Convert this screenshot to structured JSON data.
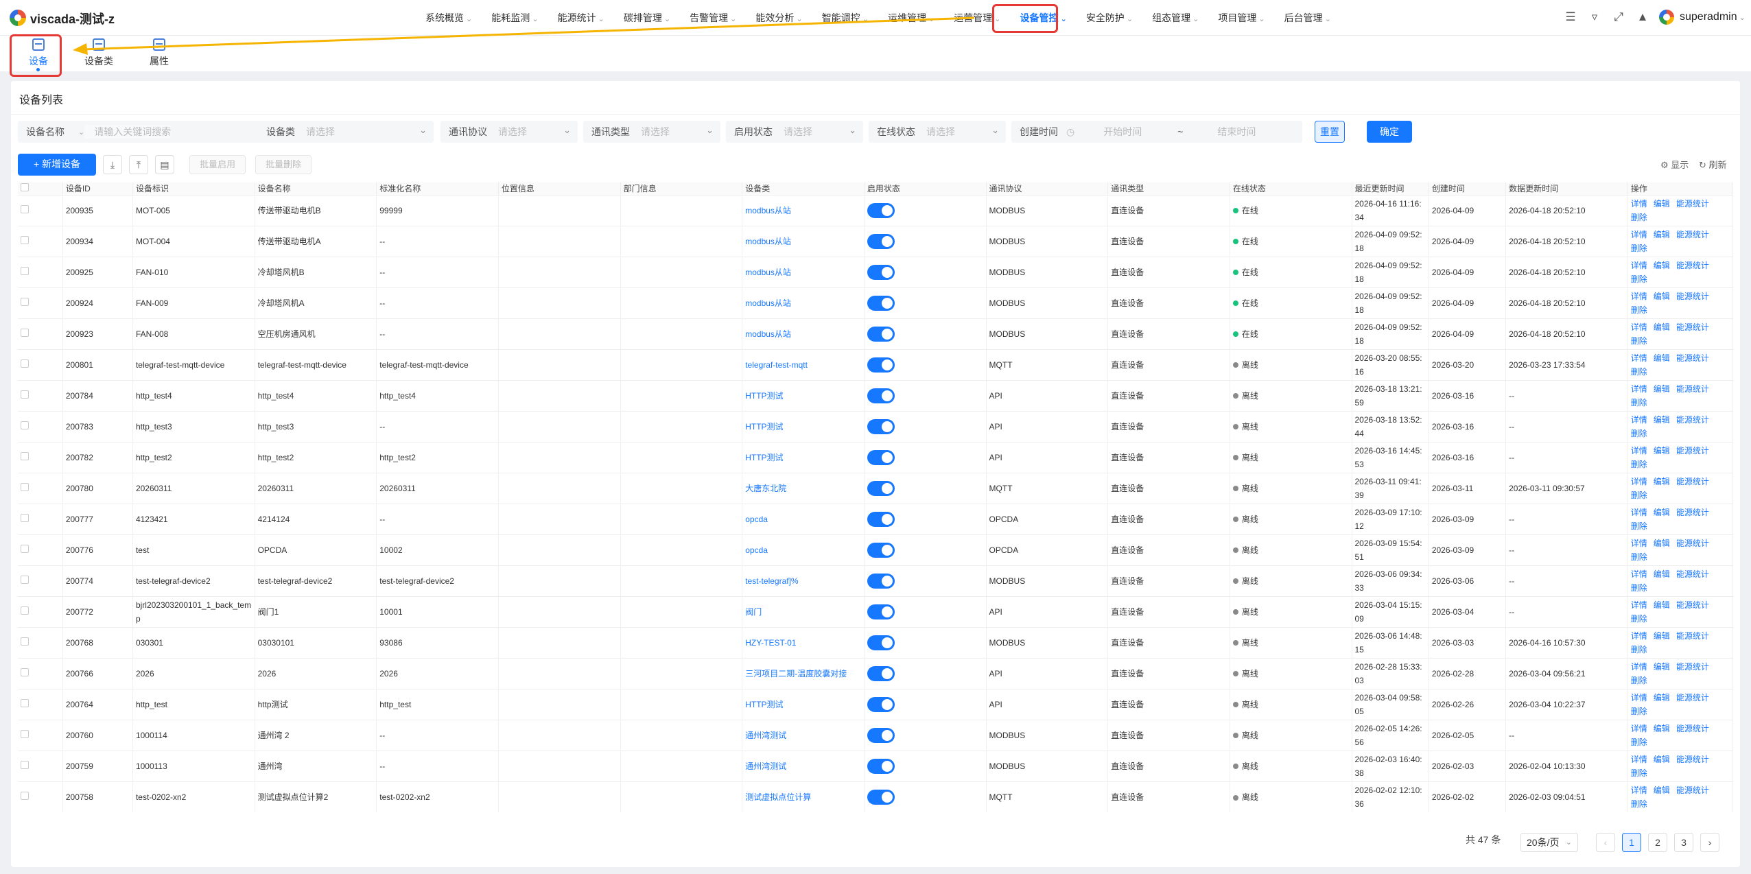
{
  "app": {
    "title": "viscada-测试-z"
  },
  "nav": {
    "items": [
      "系统概览",
      "能耗监测",
      "能源统计",
      "碳排管理",
      "告警管理",
      "能效分析",
      "智能调控",
      "运维管理",
      "运营管理",
      "设备管控",
      "安全防护",
      "组态管理",
      "项目管理",
      "后台管理"
    ],
    "active": "设备管控"
  },
  "user": {
    "name": "superadmin"
  },
  "subnav": {
    "items": [
      "设备",
      "设备类",
      "属性"
    ],
    "active": "设备"
  },
  "page": {
    "title": "设备列表"
  },
  "filters": {
    "name_select": "设备名称",
    "keyword_placeholder": "请输入关键词搜索",
    "device_class": {
      "label": "设备类",
      "placeholder": "请选择"
    },
    "protocol": {
      "label": "通讯协议",
      "placeholder": "请选择"
    },
    "comm_type": {
      "label": "通讯类型",
      "placeholder": "请选择"
    },
    "enable_status": {
      "label": "启用状态",
      "placeholder": "请选择"
    },
    "online_status": {
      "label": "在线状态",
      "placeholder": "请选择"
    },
    "created_time": {
      "label": "创建时间",
      "start": "开始时间",
      "sep": "~",
      "end": "结束时间"
    },
    "reset": "重置",
    "confirm": "确定"
  },
  "toolbar": {
    "add": "+ 新增设备",
    "batch_enable": "批量启用",
    "batch_delete": "批量删除",
    "display": "显示",
    "refresh": "刷新"
  },
  "table": {
    "columns": [
      "设备ID",
      "设备标识",
      "设备名称",
      "标准化名称",
      "位置信息",
      "部门信息",
      "设备类",
      "启用状态",
      "通讯协议",
      "通讯类型",
      "在线状态",
      "最近更新时间",
      "创建时间",
      "数据更新时间",
      "操作"
    ],
    "actions": [
      "详情",
      "编辑",
      "能源统计",
      "删除"
    ],
    "rows": [
      {
        "id": "200935",
        "key": "MOT-005",
        "name": "传送带驱动电机B",
        "std": "99999",
        "cls": "modbus从站",
        "protocol": "MODBUS",
        "type": "直连设备",
        "online": "在线",
        "updated": "2026-04-16 11:16:34",
        "created": "2026-04-09",
        "data_updated": "2026-04-18 20:52:10"
      },
      {
        "id": "200934",
        "key": "MOT-004",
        "name": "传送带驱动电机A",
        "std": "--",
        "cls": "modbus从站",
        "protocol": "MODBUS",
        "type": "直连设备",
        "online": "在线",
        "updated": "2026-04-09 09:52:18",
        "created": "2026-04-09",
        "data_updated": "2026-04-18 20:52:10"
      },
      {
        "id": "200925",
        "key": "FAN-010",
        "name": "冷却塔风机B",
        "std": "--",
        "cls": "modbus从站",
        "protocol": "MODBUS",
        "type": "直连设备",
        "online": "在线",
        "updated": "2026-04-09 09:52:18",
        "created": "2026-04-09",
        "data_updated": "2026-04-18 20:52:10"
      },
      {
        "id": "200924",
        "key": "FAN-009",
        "name": "冷却塔风机A",
        "std": "--",
        "cls": "modbus从站",
        "protocol": "MODBUS",
        "type": "直连设备",
        "online": "在线",
        "updated": "2026-04-09 09:52:18",
        "created": "2026-04-09",
        "data_updated": "2026-04-18 20:52:10"
      },
      {
        "id": "200923",
        "key": "FAN-008",
        "name": "空压机房通风机",
        "std": "--",
        "cls": "modbus从站",
        "protocol": "MODBUS",
        "type": "直连设备",
        "online": "在线",
        "updated": "2026-04-09 09:52:18",
        "created": "2026-04-09",
        "data_updated": "2026-04-18 20:52:10"
      },
      {
        "id": "200801",
        "key": "telegraf-test-mqtt-device",
        "name": "telegraf-test-mqtt-device",
        "std": "telegraf-test-mqtt-device",
        "cls": "telegraf-test-mqtt",
        "protocol": "MQTT",
        "type": "直连设备",
        "online": "离线",
        "updated": "2026-03-20 08:55:16",
        "created": "2026-03-20",
        "data_updated": "2026-03-23 17:33:54"
      },
      {
        "id": "200784",
        "key": "http_test4",
        "name": "http_test4",
        "std": "http_test4",
        "cls": "HTTP测试",
        "protocol": "API",
        "type": "直连设备",
        "online": "离线",
        "updated": "2026-03-18 13:21:59",
        "created": "2026-03-16",
        "data_updated": "--"
      },
      {
        "id": "200783",
        "key": "http_test3",
        "name": "http_test3",
        "std": "--",
        "cls": "HTTP测试",
        "protocol": "API",
        "type": "直连设备",
        "online": "离线",
        "updated": "2026-03-18 13:52:44",
        "created": "2026-03-16",
        "data_updated": "--"
      },
      {
        "id": "200782",
        "key": "http_test2",
        "name": "http_test2",
        "std": "http_test2",
        "cls": "HTTP测试",
        "protocol": "API",
        "type": "直连设备",
        "online": "离线",
        "updated": "2026-03-16 14:45:53",
        "created": "2026-03-16",
        "data_updated": "--"
      },
      {
        "id": "200780",
        "key": "20260311",
        "name": "20260311",
        "std": "20260311",
        "cls": "大唐东北院",
        "protocol": "MQTT",
        "type": "直连设备",
        "online": "离线",
        "updated": "2026-03-11 09:41:39",
        "created": "2026-03-11",
        "data_updated": "2026-03-11 09:30:57"
      },
      {
        "id": "200777",
        "key": "4123421",
        "name": "4214124",
        "std": "--",
        "cls": "opcda",
        "protocol": "OPCDA",
        "type": "直连设备",
        "online": "离线",
        "updated": "2026-03-09 17:10:12",
        "created": "2026-03-09",
        "data_updated": "--"
      },
      {
        "id": "200776",
        "key": "test",
        "name": "OPCDA",
        "std": "10002",
        "cls": "opcda",
        "protocol": "OPCDA",
        "type": "直连设备",
        "online": "离线",
        "updated": "2026-03-09 15:54:51",
        "created": "2026-03-09",
        "data_updated": "--"
      },
      {
        "id": "200774",
        "key": "test-telegraf-device2",
        "name": "test-telegraf-device2",
        "std": "test-telegraf-device2",
        "cls": "test-telegraf]%",
        "protocol": "MODBUS",
        "type": "直连设备",
        "online": "离线",
        "updated": "2026-03-06 09:34:33",
        "created": "2026-03-06",
        "data_updated": "--"
      },
      {
        "id": "200772",
        "key": "bjrl202303200101_1_back_temp",
        "name": "阀门1",
        "std": "10001",
        "cls": "阀门",
        "protocol": "API",
        "type": "直连设备",
        "online": "离线",
        "updated": "2026-03-04 15:15:09",
        "created": "2026-03-04",
        "data_updated": "--"
      },
      {
        "id": "200768",
        "key": "030301",
        "name": "03030101",
        "std": "93086",
        "cls": "HZY-TEST-01",
        "protocol": "MODBUS",
        "type": "直连设备",
        "online": "离线",
        "updated": "2026-03-06 14:48:15",
        "created": "2026-03-03",
        "data_updated": "2026-04-16 10:57:30"
      },
      {
        "id": "200766",
        "key": "2026",
        "name": "2026",
        "std": "2026",
        "cls": "三河项目二期-温度胶囊对接",
        "protocol": "API",
        "type": "直连设备",
        "online": "离线",
        "updated": "2026-02-28 15:33:03",
        "created": "2026-02-28",
        "data_updated": "2026-03-04 09:56:21"
      },
      {
        "id": "200764",
        "key": "http_test",
        "name": "http测试",
        "std": "http_test",
        "cls": "HTTP测试",
        "protocol": "API",
        "type": "直连设备",
        "online": "离线",
        "updated": "2026-03-04 09:58:05",
        "created": "2026-02-26",
        "data_updated": "2026-03-04 10:22:37"
      },
      {
        "id": "200760",
        "key": "1000114",
        "name": "通州湾 2",
        "std": "--",
        "cls": "通州湾测试",
        "protocol": "MODBUS",
        "type": "直连设备",
        "online": "离线",
        "updated": "2026-02-05 14:26:56",
        "created": "2026-02-05",
        "data_updated": "--"
      },
      {
        "id": "200759",
        "key": "1000113",
        "name": "通州湾",
        "std": "--",
        "cls": "通州湾测试",
        "protocol": "MODBUS",
        "type": "直连设备",
        "online": "离线",
        "updated": "2026-02-03 16:40:38",
        "created": "2026-02-03",
        "data_updated": "2026-02-04 10:13:30"
      },
      {
        "id": "200758",
        "key": "test-0202-xn2",
        "name": "测试虚拟点位计算2",
        "std": "test-0202-xn2",
        "cls": "测试虚拟点位计算",
        "protocol": "MQTT",
        "type": "直连设备",
        "online": "离线",
        "updated": "2026-02-02 12:10:36",
        "created": "2026-02-02",
        "data_updated": "2026-02-03 09:04:51"
      }
    ]
  },
  "pagination": {
    "total": "共 47 条",
    "page_size": "20条/页",
    "pages": [
      "1",
      "2",
      "3"
    ],
    "current": "1"
  },
  "colors": {
    "accent": "#1677ff",
    "online": "#19c37d",
    "offline": "#8a8a8a",
    "highlight": "#e53935",
    "arrow": "#f5b400"
  }
}
